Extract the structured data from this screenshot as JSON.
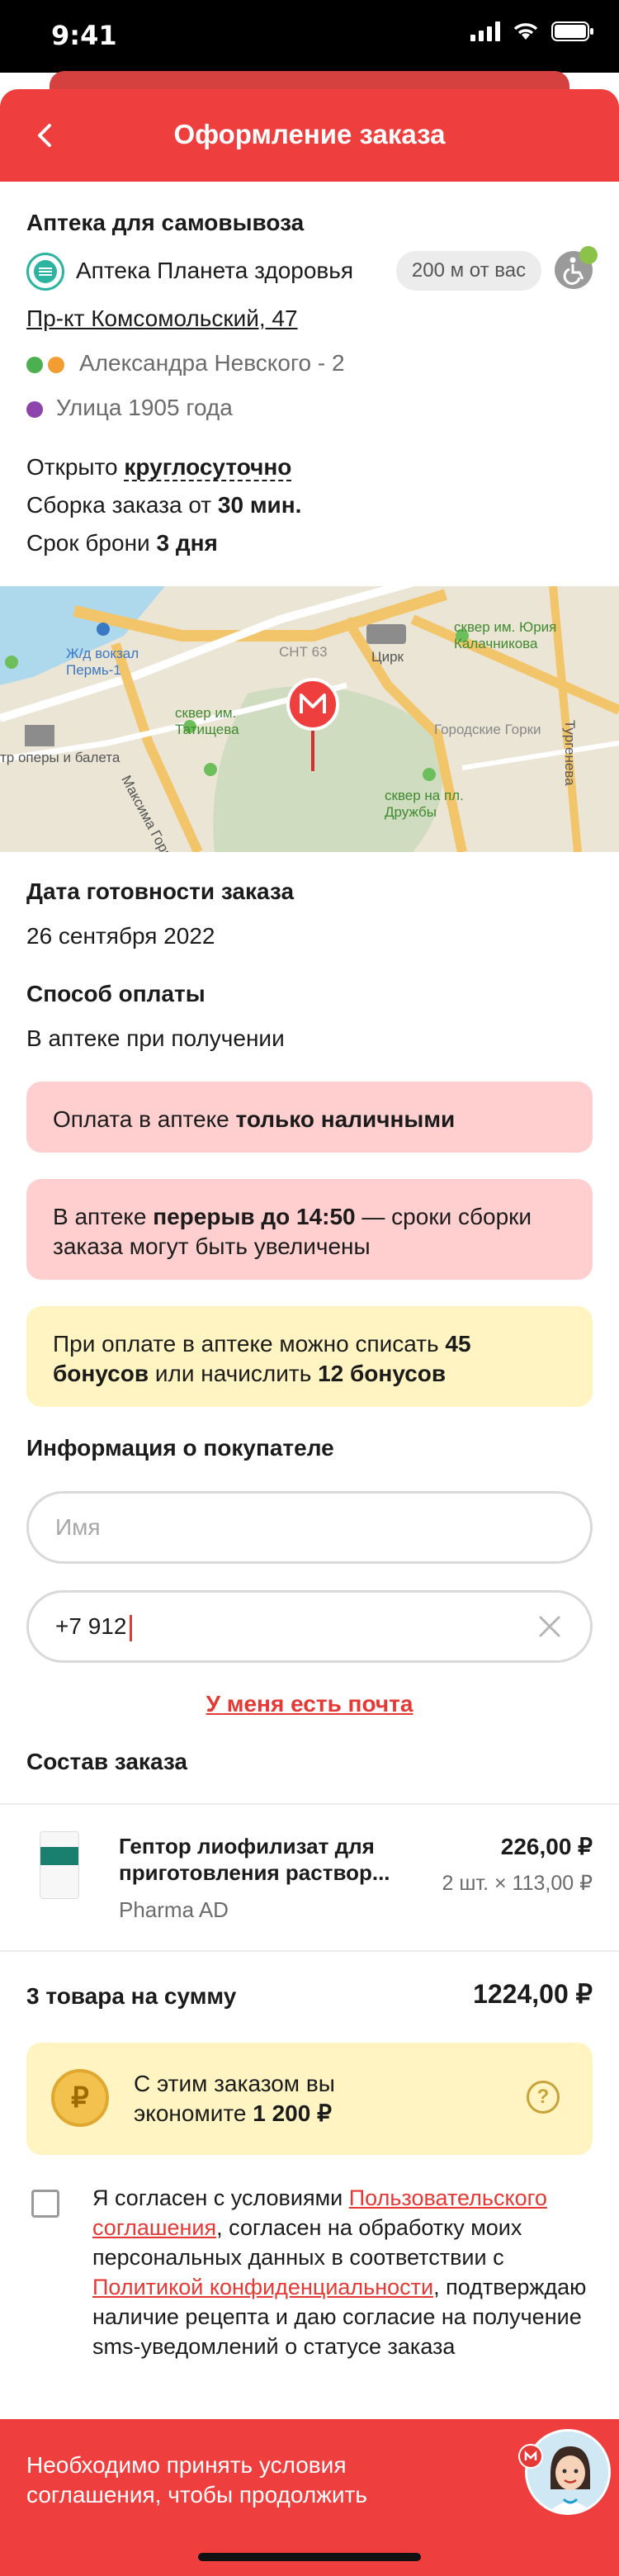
{
  "status_bar": {
    "time": "9:41"
  },
  "header": {
    "title": "Оформление заказа"
  },
  "pickup": {
    "section_title": "Аптека для самовывоза",
    "pharmacy_name": "Аптека Планета здоровья",
    "distance": "200 м от вас",
    "address": "Пр-кт Комсомольский, 47",
    "metro": [
      {
        "name": "Александра Невского - 2",
        "colors": [
          "#4caf50",
          "#f39c32"
        ]
      },
      {
        "name": "Улица 1905 года",
        "colors": [
          "#8e44ad"
        ]
      }
    ],
    "open_prefix": "Открыто ",
    "open_value": "круглосуточно",
    "assembly_prefix": "Сборка заказа от ",
    "assembly_value": "30 мин.",
    "reserve_prefix": "Срок брони ",
    "reserve_value": "3 дня"
  },
  "map": {
    "labels": {
      "station": "Ж/д вокзал Пермь-1",
      "sq1": "сквер им. Татищева",
      "sq2": "сквер им. Юрия Калачникова",
      "sq3": "сквер на пл. Дружбы",
      "circus": "Цирк",
      "snt": "СНТ 63",
      "gorki": "Городские Горки",
      "theatre": "тр оперы и балета",
      "maxim": "Максима Горь",
      "turgeneva": "Тургенева"
    }
  },
  "readiness": {
    "title": "Дата готовности заказа",
    "value": "26 сентября 2022"
  },
  "payment": {
    "title": "Способ оплаты",
    "value": "В аптеке при получении"
  },
  "notices": {
    "cash_prefix": "Оплата в аптеке ",
    "cash_bold": "только наличными",
    "break_prefix": "В аптеке ",
    "break_bold": "перерыв до 14:50",
    "break_suffix": " — сроки сборки заказа могут быть увеличены",
    "bonus_prefix": "При оплате в аптеке можно списать ",
    "bonus_bold1": "45 бонусов",
    "bonus_mid": " или начислить ",
    "bonus_bold2": "12 бонусов"
  },
  "buyer": {
    "title": "Информация о покупателе",
    "name_placeholder": "Имя",
    "phone_value": "+7 912",
    "email_link": "У меня есть почта"
  },
  "order": {
    "title": "Состав заказа",
    "items": [
      {
        "name": "Гептор лиофилизат для приготовления раствор...",
        "maker": "Pharma AD",
        "price": "226,00 ₽",
        "qty": "2 шт. × 113,00 ₽"
      }
    ],
    "total_label": "3 товара на сумму",
    "total_value": "1224,00 ₽"
  },
  "savings": {
    "prefix": "С этим заказом вы экономите ",
    "value": "1 200 ₽",
    "coin": "₽",
    "help": "?"
  },
  "agreement": {
    "t1": "Я согласен с условиями ",
    "link1": "Пользовательского соглашения",
    "t2": ", согласен на обработку моих персональных данных в соответствии с ",
    "link2": "Политикой конфиденциальности",
    "t3": ", подтверждаю наличие рецепта и даю согласие на получение sms-уведомлений о статусе заказа"
  },
  "bottom_bar": {
    "message": "Необходимо принять условия соглашения, чтобы продолжить"
  }
}
